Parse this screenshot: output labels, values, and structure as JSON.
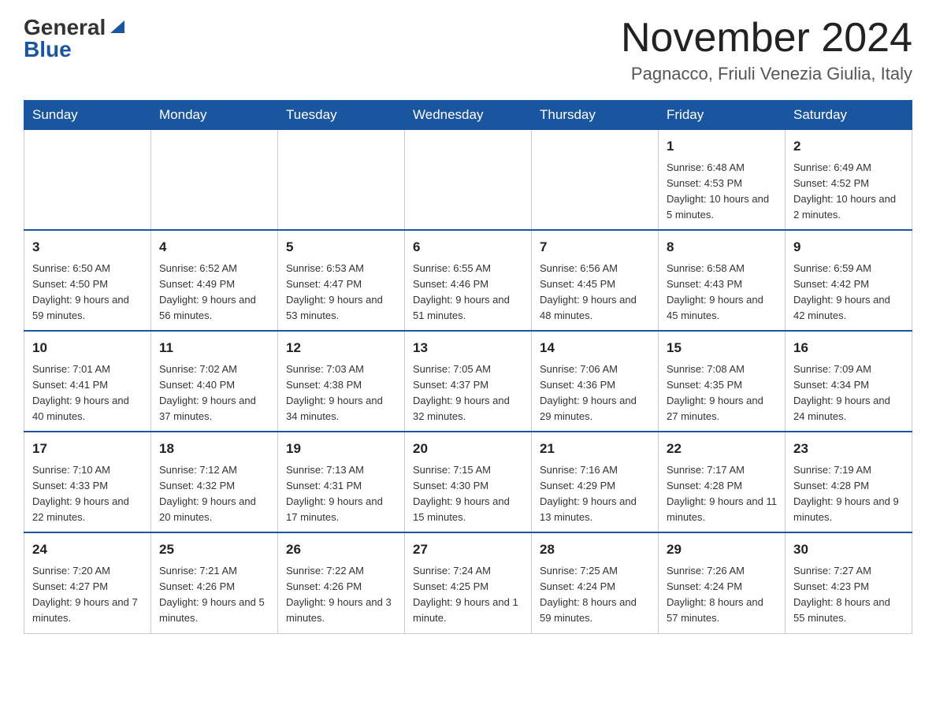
{
  "header": {
    "logo_general": "General",
    "logo_blue": "Blue",
    "month_title": "November 2024",
    "location": "Pagnacco, Friuli Venezia Giulia, Italy"
  },
  "days_of_week": [
    "Sunday",
    "Monday",
    "Tuesday",
    "Wednesday",
    "Thursday",
    "Friday",
    "Saturday"
  ],
  "weeks": [
    {
      "days": [
        {
          "num": "",
          "info": ""
        },
        {
          "num": "",
          "info": ""
        },
        {
          "num": "",
          "info": ""
        },
        {
          "num": "",
          "info": ""
        },
        {
          "num": "",
          "info": ""
        },
        {
          "num": "1",
          "info": "Sunrise: 6:48 AM\nSunset: 4:53 PM\nDaylight: 10 hours and 5 minutes."
        },
        {
          "num": "2",
          "info": "Sunrise: 6:49 AM\nSunset: 4:52 PM\nDaylight: 10 hours and 2 minutes."
        }
      ]
    },
    {
      "days": [
        {
          "num": "3",
          "info": "Sunrise: 6:50 AM\nSunset: 4:50 PM\nDaylight: 9 hours and 59 minutes."
        },
        {
          "num": "4",
          "info": "Sunrise: 6:52 AM\nSunset: 4:49 PM\nDaylight: 9 hours and 56 minutes."
        },
        {
          "num": "5",
          "info": "Sunrise: 6:53 AM\nSunset: 4:47 PM\nDaylight: 9 hours and 53 minutes."
        },
        {
          "num": "6",
          "info": "Sunrise: 6:55 AM\nSunset: 4:46 PM\nDaylight: 9 hours and 51 minutes."
        },
        {
          "num": "7",
          "info": "Sunrise: 6:56 AM\nSunset: 4:45 PM\nDaylight: 9 hours and 48 minutes."
        },
        {
          "num": "8",
          "info": "Sunrise: 6:58 AM\nSunset: 4:43 PM\nDaylight: 9 hours and 45 minutes."
        },
        {
          "num": "9",
          "info": "Sunrise: 6:59 AM\nSunset: 4:42 PM\nDaylight: 9 hours and 42 minutes."
        }
      ]
    },
    {
      "days": [
        {
          "num": "10",
          "info": "Sunrise: 7:01 AM\nSunset: 4:41 PM\nDaylight: 9 hours and 40 minutes."
        },
        {
          "num": "11",
          "info": "Sunrise: 7:02 AM\nSunset: 4:40 PM\nDaylight: 9 hours and 37 minutes."
        },
        {
          "num": "12",
          "info": "Sunrise: 7:03 AM\nSunset: 4:38 PM\nDaylight: 9 hours and 34 minutes."
        },
        {
          "num": "13",
          "info": "Sunrise: 7:05 AM\nSunset: 4:37 PM\nDaylight: 9 hours and 32 minutes."
        },
        {
          "num": "14",
          "info": "Sunrise: 7:06 AM\nSunset: 4:36 PM\nDaylight: 9 hours and 29 minutes."
        },
        {
          "num": "15",
          "info": "Sunrise: 7:08 AM\nSunset: 4:35 PM\nDaylight: 9 hours and 27 minutes."
        },
        {
          "num": "16",
          "info": "Sunrise: 7:09 AM\nSunset: 4:34 PM\nDaylight: 9 hours and 24 minutes."
        }
      ]
    },
    {
      "days": [
        {
          "num": "17",
          "info": "Sunrise: 7:10 AM\nSunset: 4:33 PM\nDaylight: 9 hours and 22 minutes."
        },
        {
          "num": "18",
          "info": "Sunrise: 7:12 AM\nSunset: 4:32 PM\nDaylight: 9 hours and 20 minutes."
        },
        {
          "num": "19",
          "info": "Sunrise: 7:13 AM\nSunset: 4:31 PM\nDaylight: 9 hours and 17 minutes."
        },
        {
          "num": "20",
          "info": "Sunrise: 7:15 AM\nSunset: 4:30 PM\nDaylight: 9 hours and 15 minutes."
        },
        {
          "num": "21",
          "info": "Sunrise: 7:16 AM\nSunset: 4:29 PM\nDaylight: 9 hours and 13 minutes."
        },
        {
          "num": "22",
          "info": "Sunrise: 7:17 AM\nSunset: 4:28 PM\nDaylight: 9 hours and 11 minutes."
        },
        {
          "num": "23",
          "info": "Sunrise: 7:19 AM\nSunset: 4:28 PM\nDaylight: 9 hours and 9 minutes."
        }
      ]
    },
    {
      "days": [
        {
          "num": "24",
          "info": "Sunrise: 7:20 AM\nSunset: 4:27 PM\nDaylight: 9 hours and 7 minutes."
        },
        {
          "num": "25",
          "info": "Sunrise: 7:21 AM\nSunset: 4:26 PM\nDaylight: 9 hours and 5 minutes."
        },
        {
          "num": "26",
          "info": "Sunrise: 7:22 AM\nSunset: 4:26 PM\nDaylight: 9 hours and 3 minutes."
        },
        {
          "num": "27",
          "info": "Sunrise: 7:24 AM\nSunset: 4:25 PM\nDaylight: 9 hours and 1 minute."
        },
        {
          "num": "28",
          "info": "Sunrise: 7:25 AM\nSunset: 4:24 PM\nDaylight: 8 hours and 59 minutes."
        },
        {
          "num": "29",
          "info": "Sunrise: 7:26 AM\nSunset: 4:24 PM\nDaylight: 8 hours and 57 minutes."
        },
        {
          "num": "30",
          "info": "Sunrise: 7:27 AM\nSunset: 4:23 PM\nDaylight: 8 hours and 55 minutes."
        }
      ]
    }
  ]
}
